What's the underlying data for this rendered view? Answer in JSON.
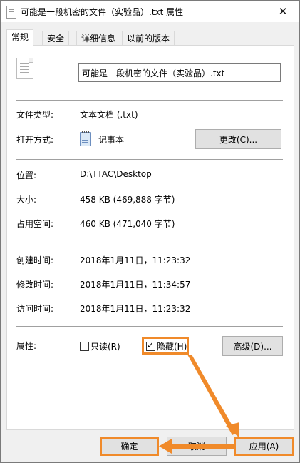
{
  "window": {
    "title": "可能是一段机密的文件（实验品）.txt 属性",
    "close_glyph": "✕"
  },
  "tabs": [
    {
      "label": "常规",
      "active": true
    },
    {
      "label": "安全",
      "active": false
    },
    {
      "label": "详细信息",
      "active": false
    },
    {
      "label": "以前的版本",
      "active": false
    }
  ],
  "general": {
    "file_name": "可能是一段机密的文件（实验品）.txt",
    "file_type_label": "文件类型:",
    "file_type_value": "文本文档 (.txt)",
    "opens_with_label": "打开方式:",
    "opens_with_value": "记事本",
    "change_button": "更改(C)...",
    "location_label": "位置:",
    "location_value": "D:\\TTAC\\Desktop",
    "size_label": "大小:",
    "size_value": "458 KB (469,888 字节)",
    "size_on_disk_label": "占用空间:",
    "size_on_disk_value": "460 KB (471,040 字节)",
    "created_label": "创建时间:",
    "created_value": "2018年1月11日，11:23:32",
    "modified_label": "修改时间:",
    "modified_value": "2018年1月11日，11:34:57",
    "accessed_label": "访问时间:",
    "accessed_value": "2018年1月11日，11:23:32",
    "attributes_label": "属性:",
    "readonly_label": "只读(R)",
    "readonly_checked": false,
    "hidden_label": "隐藏(H)",
    "hidden_checked": true,
    "advanced_button": "高级(D)..."
  },
  "footer": {
    "ok_button": "确定",
    "cancel_button": "取消",
    "apply_button": "应用(A)"
  },
  "colors": {
    "highlight": "#f08a2a",
    "panel_bg": "#ffffff",
    "window_bg": "#f0f0f0"
  },
  "icons": {
    "title": "text-file-icon",
    "file": "text-document-icon",
    "notepad": "notepad-icon",
    "close": "close-icon",
    "check": "checkmark-icon"
  }
}
